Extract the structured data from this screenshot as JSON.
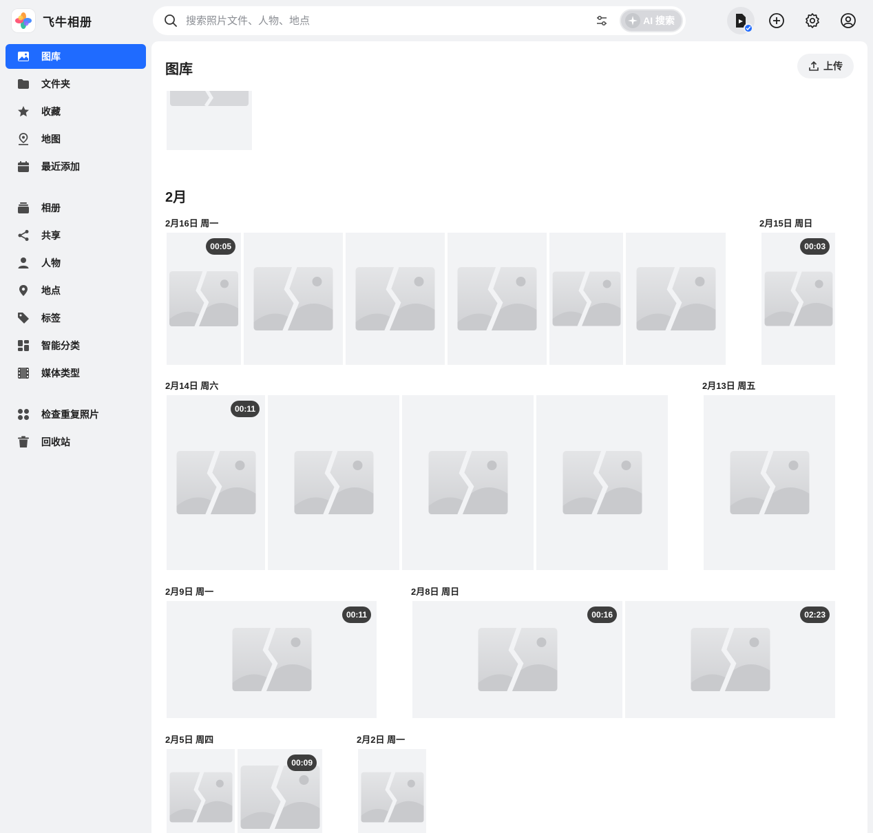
{
  "app": {
    "name": "飞牛相册",
    "logo_icon": "flower-logo-icon"
  },
  "search": {
    "placeholder": "搜索照片文件、人物、地点",
    "ai_label": "AI 搜索"
  },
  "sidebar": {
    "items": [
      {
        "label": "图库",
        "icon": "photo-icon",
        "active": true
      },
      {
        "label": "文件夹",
        "icon": "folder-icon"
      },
      {
        "label": "收藏",
        "icon": "star-icon"
      },
      {
        "label": "地图",
        "icon": "map-pin-icon"
      },
      {
        "label": "最近添加",
        "icon": "calendar-icon"
      },
      {
        "label": "相册",
        "icon": "album-icon"
      },
      {
        "label": "共享",
        "icon": "share-icon"
      },
      {
        "label": "人物",
        "icon": "person-icon"
      },
      {
        "label": "地点",
        "icon": "location-icon"
      },
      {
        "label": "标签",
        "icon": "tag-icon"
      },
      {
        "label": "智能分类",
        "icon": "grid-icon"
      },
      {
        "label": "媒体类型",
        "icon": "film-icon"
      },
      {
        "label": "检查重复照片",
        "icon": "duplicate-icon"
      },
      {
        "label": "回收站",
        "icon": "trash-icon"
      }
    ]
  },
  "main": {
    "title": "图库",
    "upload_label": "上传",
    "month": "2月",
    "dates": [
      "2月16日 周一",
      "2月15日 周日",
      "2月14日 周六",
      "2月13日 周五",
      "2月9日 周一",
      "2月8日 周日",
      "2月5日 周四",
      "2月2日 周一"
    ],
    "durations": [
      "00:05",
      "00:03",
      "00:11",
      "00:11",
      "00:16",
      "02:23",
      "00:09"
    ]
  },
  "colors": {
    "accent": "#1f6bff",
    "background": "#f1f2f4",
    "tile": "#f2f3f5"
  }
}
